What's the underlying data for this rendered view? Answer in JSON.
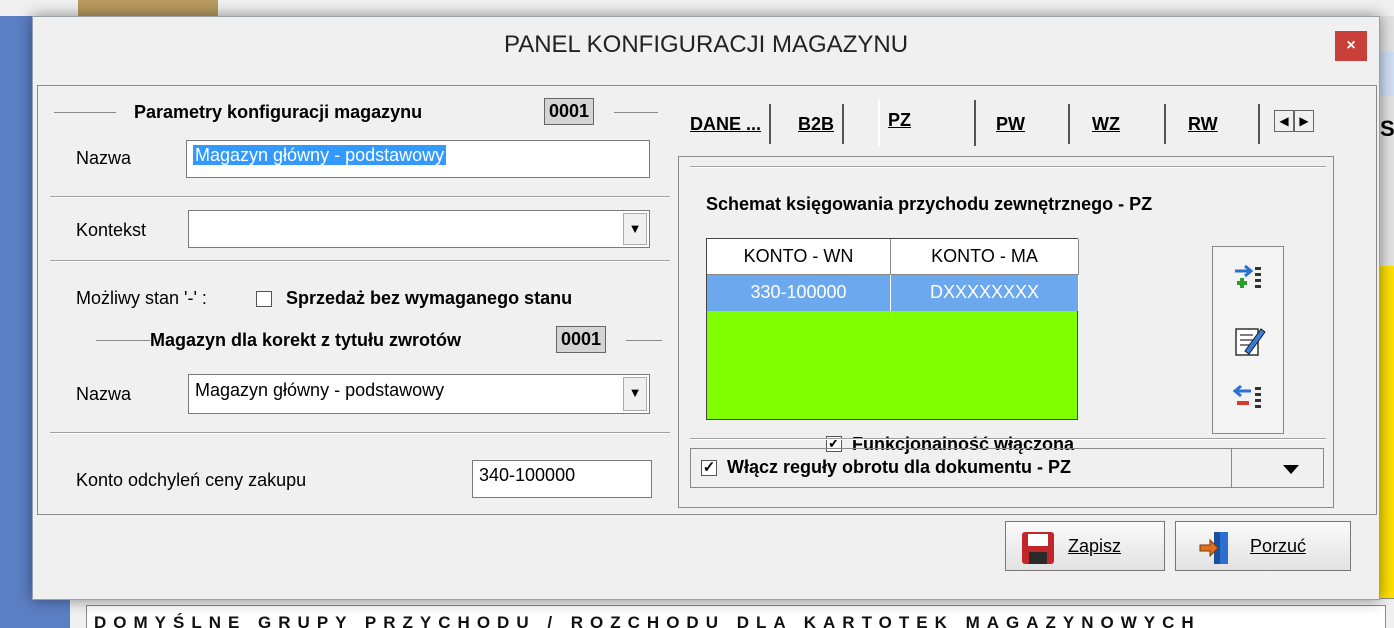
{
  "window": {
    "title": "PANEL KONFIGURACJI MAGAZYNU",
    "close_glyph": "×"
  },
  "left": {
    "group1_title": "Parametry konfiguracji magazynu",
    "group1_code": "0001",
    "name_label": "Nazwa",
    "name_value": "Magazyn główny - podstawowy",
    "context_label": "Kontekst",
    "context_value": "",
    "stock_label": "Możliwy stan '-' :",
    "sale_label": "Sprzedaż bez wymaganego stanu",
    "group2_title": "Magazyn dla korekt z tytułu zwrotów",
    "group2_code": "0001",
    "name2_label": "Nazwa",
    "name2_value": "Magazyn główny - podstawowy",
    "deviation_label": "Konto odchyleń  ceny  zakupu",
    "deviation_value": "340-100000"
  },
  "tabs": [
    {
      "label": "DANE ..."
    },
    {
      "label": "B2B"
    },
    {
      "label": "PZ",
      "active": true
    },
    {
      "label": "PW"
    },
    {
      "label": "WZ"
    },
    {
      "label": "RW"
    }
  ],
  "tab_nav": {
    "prev": "◀",
    "next": "▶"
  },
  "pz": {
    "scheme_title": "Schemat księgowania przychodu zewnętrznego - PZ",
    "columns": [
      "KONTO - WN",
      "KONTO - MA"
    ],
    "rows": [
      [
        "330-100000",
        "DXXXXXXXX"
      ]
    ],
    "functional_label": "Funkcjonalność włączona",
    "functional_checked": true,
    "rules_label": "Włącz reguły obrotu dla dokumentu - PZ",
    "rules_checked": true,
    "tools": [
      "add-row-icon",
      "edit-icon",
      "remove-row-icon"
    ]
  },
  "buttons": {
    "save_label": "Zapisz",
    "cancel_label": "Porzuć",
    "save_icon": "floppy-disk-icon",
    "cancel_icon": "exit-door-icon"
  },
  "background": {
    "bottom_text": "DOMYŚLNE GRUPY PRZYCHODU / ROZCHODU DLA KARTOTEK MAGAZYNOWYCH",
    "side_char": "S"
  },
  "colors": {
    "grid_bg": "#80ff00",
    "selected_row": "#6ba8ee",
    "close_btn": "#c9403a"
  }
}
